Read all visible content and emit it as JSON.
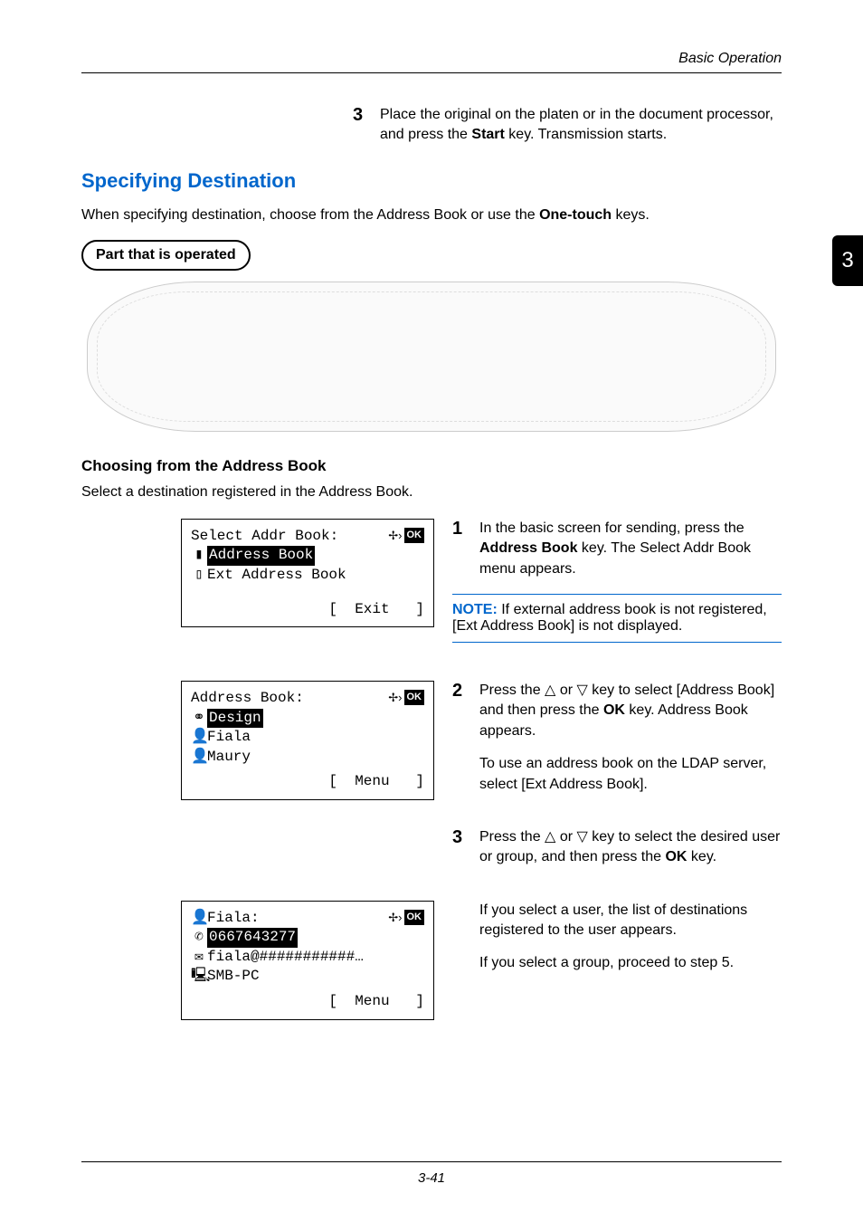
{
  "header": {
    "section": "Basic Operation",
    "chapter": "3"
  },
  "top_step": {
    "num": "3",
    "pre": "Place the original on the platen or in the document processor, and press the ",
    "bold": "Start",
    "post": " key. Transmission starts."
  },
  "section": {
    "title": "Specifying Destination",
    "intro_pre": "When specifying destination, choose from the Address Book or use the ",
    "intro_bold": "One-touch",
    "intro_post": " keys.",
    "pill": "Part that is operated"
  },
  "sub": {
    "title": "Choosing from the Address Book",
    "intro": "Select a destination registered in the Address Book."
  },
  "lcd_common": {
    "ok": "OK"
  },
  "lcd1": {
    "title": "Select Addr Book",
    "items": [
      "Address Book",
      "Ext Address Book"
    ],
    "softkey": "Exit"
  },
  "lcd2": {
    "title": "Address Book",
    "items": [
      "Design",
      "Fiala",
      "Maury"
    ],
    "softkey": "Menu"
  },
  "lcd3": {
    "title": "Fiala",
    "items": [
      "0667643277",
      "fiala@###########…",
      "SMB-PC"
    ],
    "softkey": "Menu"
  },
  "steps": [
    {
      "num": "1",
      "pre": "In the basic screen for sending, press the ",
      "bold": "Address Book",
      "post": " key. The Select Addr Book menu appears."
    },
    {
      "num": "2",
      "pre": "Press the",
      "mid1": "or",
      "mid2": "key to select [Address Book] and then press the ",
      "bold": "OK",
      "post": " key. Address Book appears.",
      "extra": "To use an address book on the LDAP server, select [Ext Address Book]."
    },
    {
      "num": "3",
      "pre": "Press the",
      "mid1": "or",
      "mid2": "key to select the desired user or group, and then press the ",
      "bold": "OK",
      "post": " key.",
      "extra1": "If you select a user, the list of destinations registered to the user appears.",
      "extra2": "If you select a group, proceed to step 5."
    }
  ],
  "note": {
    "label": "NOTE:",
    "text": " If external address book is not registered, [Ext Address Book] is not displayed."
  },
  "footer": {
    "page": "3-41"
  }
}
